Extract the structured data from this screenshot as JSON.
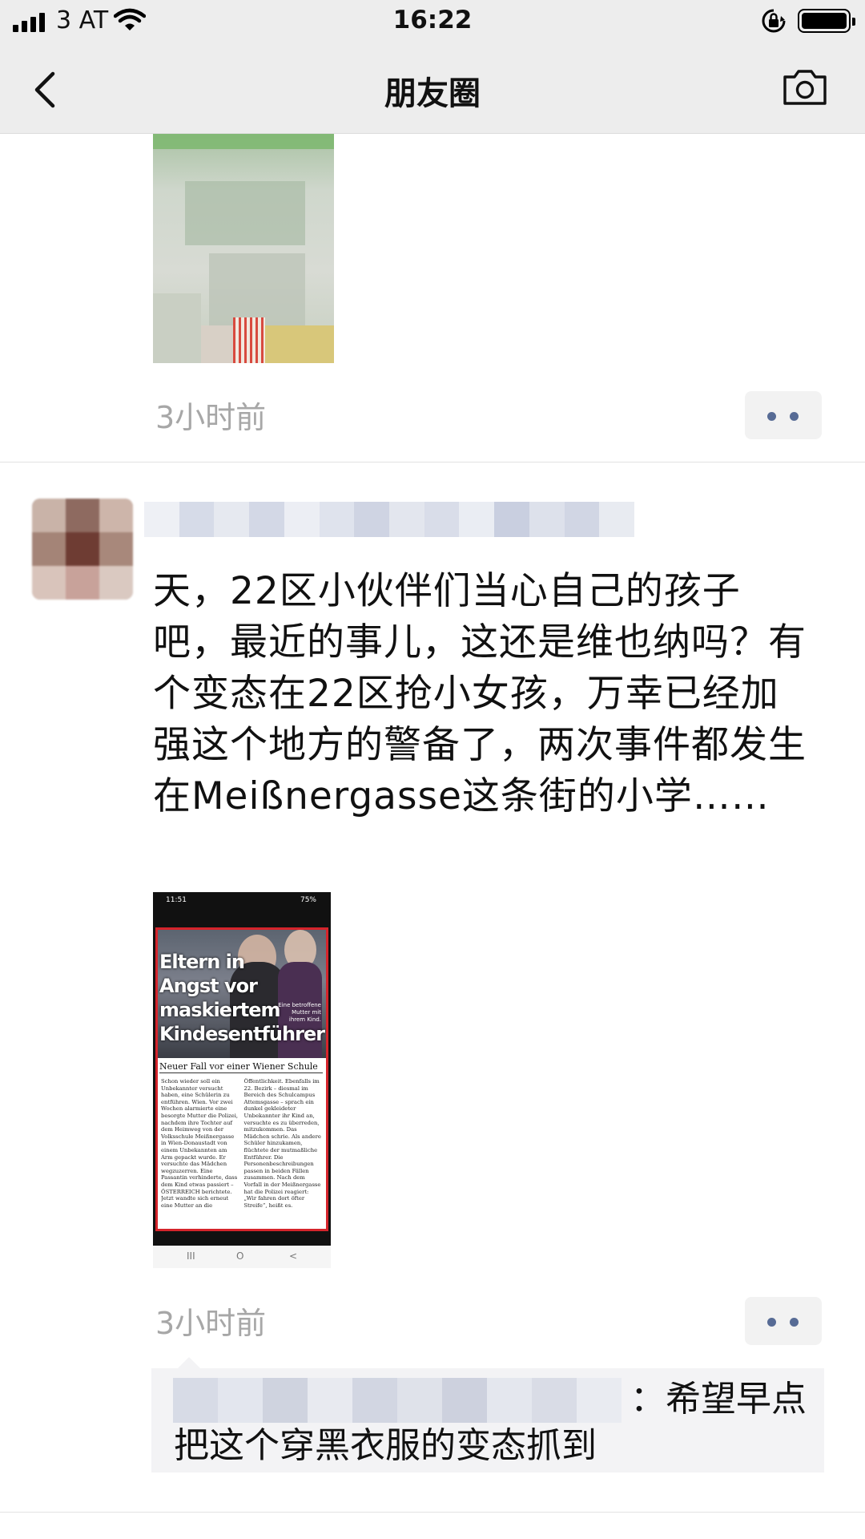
{
  "status_bar": {
    "carrier": "3 AT",
    "time": "16:22"
  },
  "nav": {
    "title": "朋友圈"
  },
  "posts": [
    {
      "time": "3小时前"
    },
    {
      "text": "天，22区小伙伴们当心自己的孩子吧，最近的事儿，这还是维也纳吗？有个变态在22区抢小女孩，万幸已经加强这个地方的警备了，两次事件都发生在Meißnergasse这条街的小学……",
      "image": {
        "status_time": "11:51",
        "status_right": "75%",
        "headline": "Eltern in Angst vor maskiertem Kindesentführer",
        "caption": "Eine betroffene Mutter mit ihrem Kind.",
        "subheadline": "Neuer Fall vor einer Wiener Schule",
        "body": "Schon wieder soll ein Unbekannter versucht haben, eine Schülerin zu entführen. Wien. Vor zwei Wochen alarmierte eine besorgte Mutter die Polizei, nachdem ihre Tochter auf dem Heimweg von der Volksschule Meißnergasse in Wien-Donaustadt von einem Unbekannten am Arm gepackt wurde. Er versuchte das Mädchen wegzuzerren. Eine Passantin verhinderte, dass dem Kind etwas passiert – ÖSTERREICH berichtete. Jetzt wandte sich erneut eine Mutter an die Öffentlichkeit. Ebenfalls im 22. Bezirk – diesmal im Bereich des Schulcampus Attemsgasse – sprach ein dunkel gekleideter Unbekannter ihr Kind an, versuchte es zu überreden, mitzukommen. Das Mädchen schrie. Als andere Schüler hinzukamen, flüchtete der mutmaßliche Entführer. Die Personenbeschreibungen passen in beiden Fällen zusammen. Nach dem Vorfall in der Meißnergasse hat die Polizei reagiert: „Wir fahren dort öfter Streife“, heißt es.",
        "nav_glyphs": [
          "III",
          "O",
          "<"
        ]
      },
      "time": "3小时前",
      "comment": {
        "text": "：希望早点把这个穿黑衣服的变态抓到"
      }
    }
  ]
}
